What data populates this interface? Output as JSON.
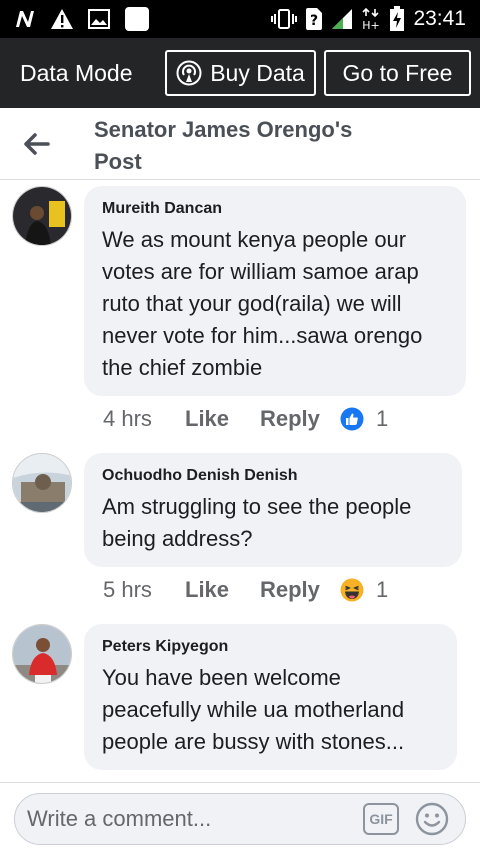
{
  "status_bar": {
    "time": "23:41",
    "icons": [
      "n-icon",
      "warning-icon",
      "image-icon",
      "square-icon",
      "vibrate-icon",
      "sim-question-icon",
      "signal-icon",
      "hplus-icon",
      "battery-charging-icon"
    ]
  },
  "data_bar": {
    "mode_label": "Data Mode",
    "buy_label": "Buy Data",
    "free_label": "Go to Free"
  },
  "header": {
    "title": "Senator James Orengo's Post"
  },
  "comments": [
    {
      "author": "Mureith Dancan",
      "text": "We as mount kenya people our votes are for william samoe arap ruto that your god(raila) we will never vote for him...sawa orengo the chief zombie",
      "time": "4 hrs",
      "like_label": "Like",
      "reply_label": "Reply",
      "reaction": "like-reaction-icon",
      "reaction_count": "1"
    },
    {
      "author": "Ochuodho Denish Denish",
      "text": "Am struggling to see the people being address?",
      "time": "5 hrs",
      "like_label": "Like",
      "reply_label": "Reply",
      "reaction": "haha-reaction-icon",
      "reaction_count": "1"
    },
    {
      "author": "Peters Kipyegon",
      "text": "You have been welcome peacefully while ua motherland people are bussy with stones...",
      "time": "",
      "like_label": "",
      "reply_label": "",
      "reaction": "",
      "reaction_count": ""
    }
  ],
  "composer": {
    "placeholder": "Write a comment...",
    "gif_label": "GIF"
  },
  "colors": {
    "status_bar": "#000000",
    "data_bar": "#242526",
    "bubble": "#f0f2f5",
    "like_blue": "#1877f2"
  }
}
